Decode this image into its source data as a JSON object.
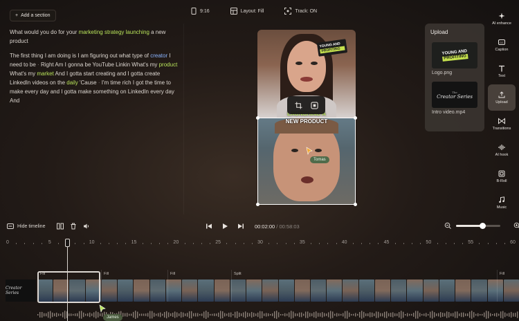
{
  "header": {
    "add_section": "Add a section",
    "aspect": "9:16",
    "layout": "Layout: Fill",
    "track": "Track: ON"
  },
  "transcript": {
    "p1": [
      {
        "t": "What would you do for your ",
        "c": ""
      },
      {
        "t": "marketing strategy launching",
        "c": "green"
      },
      {
        "t": " a new product",
        "c": ""
      }
    ],
    "p2": [
      {
        "t": "The first thing I am doing is I am figuring out what type of ",
        "c": ""
      },
      {
        "t": "creator",
        "c": "blue"
      },
      {
        "t": " I need to be ",
        "c": ""
      },
      {
        "t": "·",
        "c": "dot"
      },
      {
        "t": " Right Am I gonna be YouTube Linkin What's my ",
        "c": ""
      },
      {
        "t": "product",
        "c": "green"
      },
      {
        "t": " What's my ",
        "c": ""
      },
      {
        "t": "market",
        "c": "green"
      },
      {
        "t": " And I gotta start creating and I gotta create LinkedIn videos on the ",
        "c": ""
      },
      {
        "t": "daily",
        "c": "green"
      },
      {
        "t": " 'Cause ",
        "c": ""
      },
      {
        "t": "·",
        "c": "dot"
      },
      {
        "t": " I'm time rich I got the time to make every day and I gotta make something on LinkedIn every day And",
        "c": ""
      }
    ]
  },
  "preview": {
    "sticker_line1": "YOUNG AND",
    "sticker_line2": "PROFITING",
    "caption_line1": "LAUNCHING A",
    "caption_line2": "NEW PRODUCT",
    "cursor_tomas": "Tomas"
  },
  "upload_panel": {
    "title": "Upload",
    "items": [
      {
        "label": "Logo.png",
        "thumb_line1": "YOUNG AND",
        "thumb_line2": "PROFITING"
      },
      {
        "label": "Intro video.mp4",
        "thumb_text": "Creator Series",
        "thumb_small": "The"
      }
    ]
  },
  "rail": [
    {
      "label": "AI enhance",
      "icon": "sparkle-icon",
      "active": false
    },
    {
      "label": "Caption",
      "icon": "caption-icon",
      "active": false
    },
    {
      "label": "Text",
      "icon": "text-icon",
      "active": false
    },
    {
      "label": "Upload",
      "icon": "upload-icon",
      "active": true
    },
    {
      "label": "Transitions",
      "icon": "transitions-icon",
      "active": false
    },
    {
      "label": "AI hook",
      "icon": "waveform-icon",
      "active": false
    },
    {
      "label": "B-Roll",
      "icon": "broll-icon",
      "active": false
    },
    {
      "label": "Music",
      "icon": "music-icon",
      "active": false
    }
  ],
  "timeline": {
    "hide_label": "Hide timeline",
    "current_time": "00:02:00",
    "total_time": "00:58:03",
    "zoom_level": 0.6,
    "ticks": [
      "0",
      "5",
      "10",
      "15",
      "20",
      "25",
      "30",
      "35",
      "40",
      "45",
      "50",
      "55",
      "60"
    ],
    "segments": [
      {
        "label": "Fill"
      },
      {
        "label": "Fill"
      },
      {
        "label": "Split"
      },
      {
        "label": "Fill"
      }
    ],
    "intro_clip_text": "Creator Series",
    "cursor_james": "James"
  },
  "colors": {
    "accent_green": "#b8e35a",
    "accent_blue": "#8ab4ff",
    "cursor_green": "#3c5a3f"
  }
}
